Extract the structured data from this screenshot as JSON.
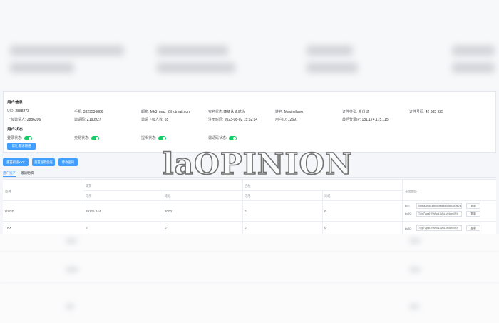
{
  "watermark": "laOPINION",
  "user_info": {
    "title": "用户信息",
    "uid_label": "UID:",
    "uid": "2888273",
    "phone_label": "手机:",
    "phone": "3329536886",
    "email_label": "邮箱:",
    "email": "Mk3_max_@hotmail.com",
    "real_name_status_label": "实名状态:",
    "real_name_status": "高级认证成功",
    "name_label": "姓名:",
    "name": "Maximiliano",
    "id_type_label": "证件类型:",
    "id_type": "身份证",
    "id_number_label": "证件号码:",
    "id_number": "42 685 925",
    "inviter_label": "上级邀请人:",
    "inviter": "2886206",
    "invite_code_label": "邀请码:",
    "invite_code": "Z190927",
    "invitees_label": "邀请下级人数:",
    "invitees": "55",
    "register_time_label": "注册时间:",
    "register_time": "2023-08-02 15:52:14",
    "user_id_label": "用户ID:",
    "user_id": "12697",
    "last_ip_label": "最后登录IP:",
    "last_ip": "181.174.175.115"
  },
  "user_status": {
    "title": "用户状态",
    "login_label": "登录状态:",
    "trade_label": "交易状态:",
    "withdraw_label": "提币状态:",
    "invite_code_label": "邀请码状态:",
    "button": "帮忙邀请网络"
  },
  "actions": [
    "重置初级KYC",
    "重置谷歌验证",
    "修改密码"
  ],
  "tabs": [
    "用户资产",
    "邀请明细"
  ],
  "table": {
    "col_currency": "币种",
    "group_spot": "现货",
    "group_contract": "合约",
    "col_address": "充币地址",
    "sub_available": "可用",
    "sub_frozen": "冻结",
    "sub_available2": "可用",
    "sub_frozen2": "冻结",
    "rows": [
      {
        "currency": "USDT",
        "spot_available": "89125.244",
        "spot_frozen": "2000",
        "contract_available": "0",
        "contract_frozen": "0",
        "addresses": [
          {
            "label": "Erc:",
            "value": "0xbea2b887a8bcc0f6d4d0c58d3e2fe2bf",
            "copy": "复制"
          },
          {
            "label": "trc20:",
            "value": "TQp7Vpu67RhPoN1MuLnX4wrc0PX",
            "copy": "复制"
          }
        ]
      },
      {
        "currency": "TRX",
        "spot_available": "0",
        "spot_frozen": "0",
        "contract_available": "0",
        "contract_frozen": "0",
        "addresses": [
          {
            "label": "trc20:",
            "value": "TQp7Vpu67RhPoN1MuLnX4wrc0PX",
            "copy": "复制"
          }
        ]
      }
    ]
  }
}
